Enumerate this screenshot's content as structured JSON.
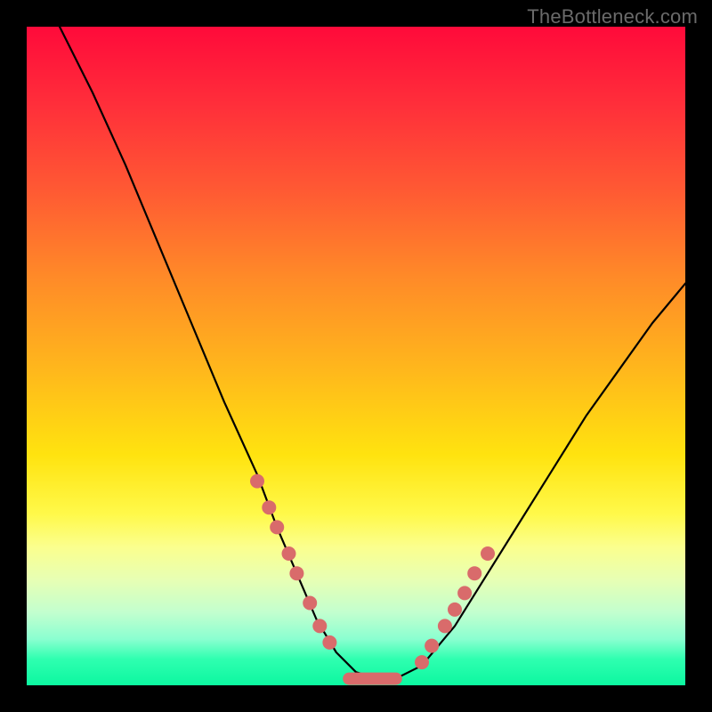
{
  "watermark": "TheBottleneck.com",
  "chart_data": {
    "type": "line",
    "title": "",
    "xlabel": "",
    "ylabel": "",
    "xlim": [
      0,
      100
    ],
    "ylim": [
      0,
      100
    ],
    "grid": false,
    "series": [
      {
        "name": "curve",
        "x": [
          5,
          10,
          15,
          20,
          25,
          30,
          35,
          38,
          41,
          44,
          47,
          50,
          53,
          56,
          60,
          65,
          70,
          75,
          80,
          85,
          90,
          95,
          100
        ],
        "y": [
          100,
          90,
          79,
          67,
          55,
          43,
          32,
          24,
          17,
          10,
          5,
          2,
          1,
          1,
          3,
          9,
          17,
          25,
          33,
          41,
          48,
          55,
          61
        ]
      }
    ],
    "markers": [
      {
        "name": "dots-left",
        "color": "#d96b6b",
        "x": [
          35.0,
          36.8,
          38.0,
          39.8,
          41.0,
          43.0,
          44.5,
          46.0
        ],
        "y": [
          31.0,
          27.0,
          24.0,
          20.0,
          17.0,
          12.5,
          9.0,
          6.5
        ]
      },
      {
        "name": "dots-right",
        "color": "#d96b6b",
        "x": [
          60.0,
          61.5,
          63.5,
          65.0,
          66.5,
          68.0,
          70.0
        ],
        "y": [
          3.5,
          6.0,
          9.0,
          11.5,
          14.0,
          17.0,
          20.0
        ]
      },
      {
        "name": "plateau",
        "color": "#d96b6b",
        "x": [
          48,
          57
        ],
        "y": [
          1,
          1
        ]
      }
    ],
    "background": "rainbow-vertical-gradient"
  }
}
